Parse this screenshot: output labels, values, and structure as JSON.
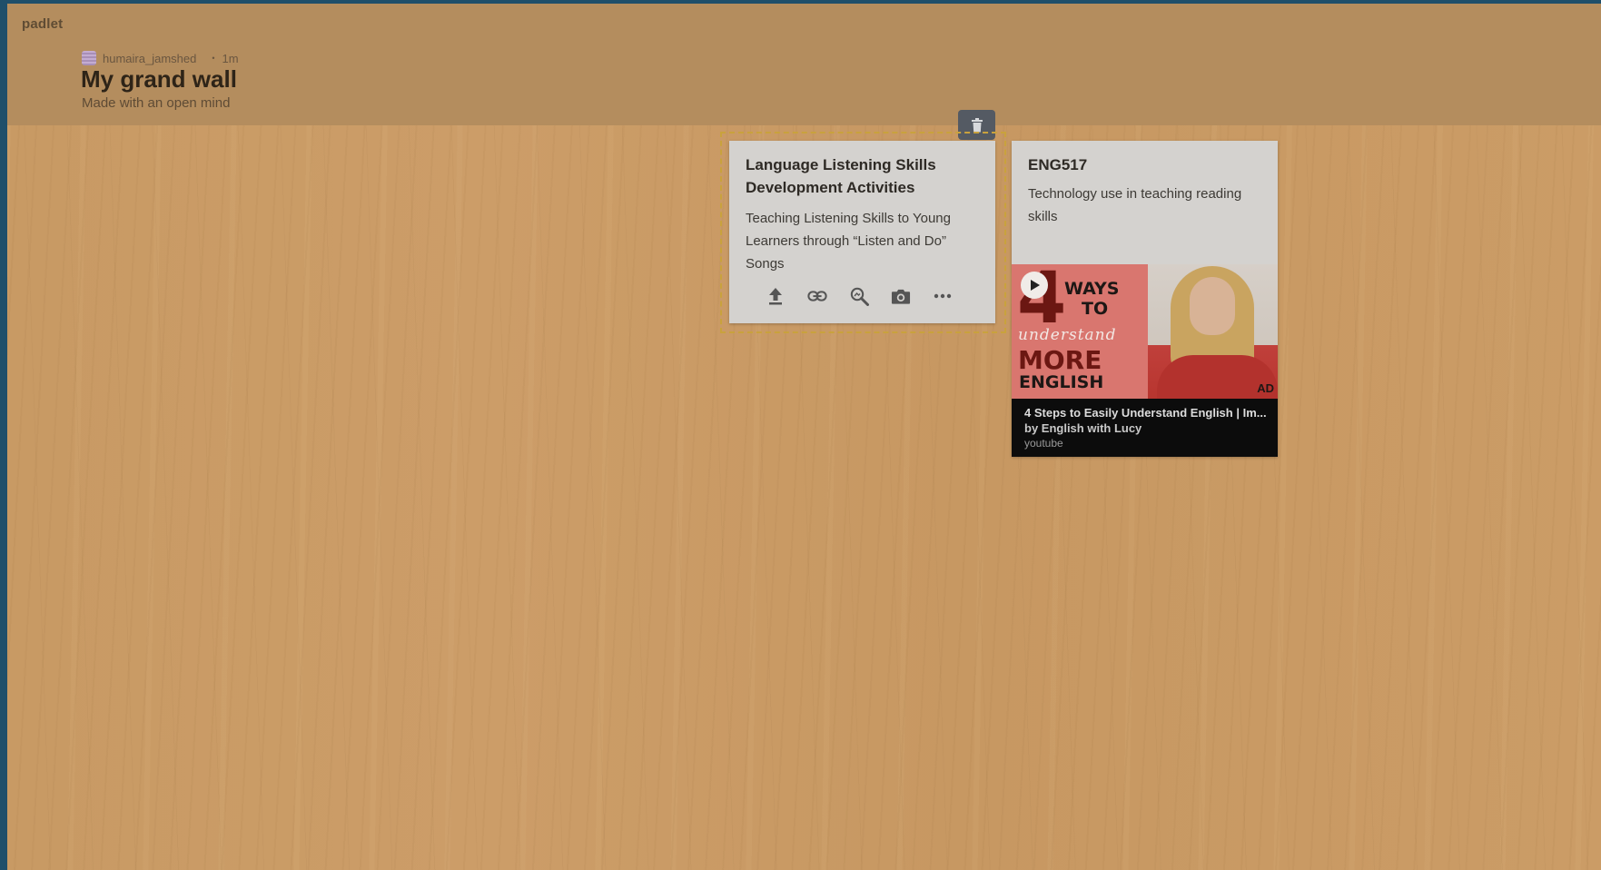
{
  "app": {
    "brand": "padlet"
  },
  "header": {
    "author": "humaira_jamshed",
    "time_ago": "1m",
    "separator": "•",
    "title": "My grand wall",
    "subtitle": "Made with an open mind"
  },
  "posts": [
    {
      "title": "Language Listening Skills Development Activities",
      "body": " Teaching Listening Skills to Young Learners through “Listen and Do” Songs",
      "toolbar": [
        "upload-icon",
        "link-icon",
        "search-image-icon",
        "camera-icon",
        "more-icon"
      ]
    },
    {
      "title": "ENG517",
      "body": "Technology use in teaching reading skills",
      "attachment": {
        "thumbnail_text": {
          "number": "4",
          "line1": "WAYS",
          "line2": "TO",
          "line3": "understand",
          "line4": "MORE",
          "line5": "ENGLISH",
          "badge": "AD"
        },
        "video_title": "4 Steps to Easily Understand English | Im...",
        "video_author": "by English with Lucy",
        "source": "youtube"
      }
    }
  ],
  "colors": {
    "header_bg": "#b48d5e",
    "card_bg": "#d4d2cf",
    "selection_outline": "#c9a23d",
    "delete_button": "#545a63"
  }
}
